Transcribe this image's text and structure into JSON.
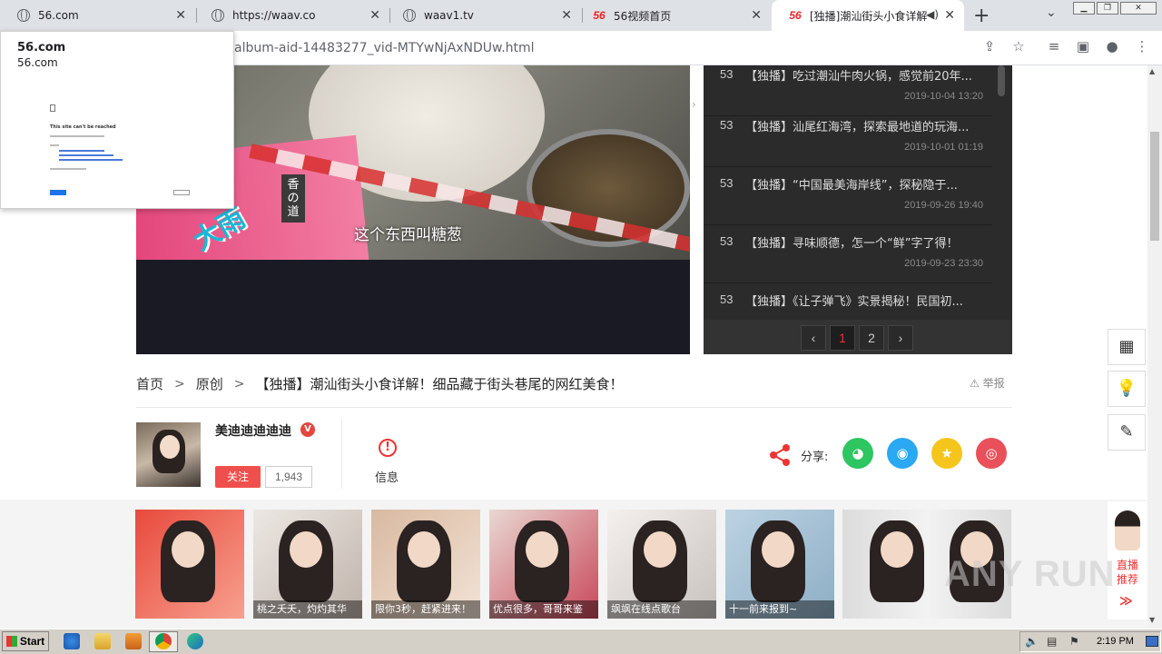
{
  "browser": {
    "tabs": [
      {
        "label": "56.com"
      },
      {
        "label": "https://waav.co"
      },
      {
        "label": "waav1.tv"
      },
      {
        "label": "56视频首页"
      },
      {
        "label": "[独播]潮汕街头小食详解"
      }
    ],
    "url": "album-aid-14483277_vid-MTYwNjAxNDUw.html"
  },
  "popup": {
    "title": "56.com",
    "url": "56.com",
    "error_text": "This site can't be reached"
  },
  "video": {
    "subtitle": "这个东西叫糖葱",
    "overlay_big": "大雨",
    "overlay_vertical": "香の道"
  },
  "playlist": {
    "items": [
      {
        "num": "53",
        "title": "【独播】吃过潮汕牛肉火锅，感觉前20年...",
        "date": "2019-10-04 13:20"
      },
      {
        "num": "53",
        "title": "【独播】汕尾红海湾，探索最地道的玩海...",
        "date": "2019-10-01 01:19"
      },
      {
        "num": "53",
        "title": "【独播】“中国最美海岸线”，探秘隐于...",
        "date": "2019-09-26 19:40"
      },
      {
        "num": "53",
        "title": "【独播】寻味顺德，怎一个“鲜”字了得！",
        "date": "2019-09-23 23:30"
      },
      {
        "num": "53",
        "title": "【独播】《让子弹飞》实景揭秘！民国初...",
        "date": ""
      }
    ],
    "pages": [
      "1",
      "2"
    ],
    "prev": "‹",
    "next": "›"
  },
  "breadcrumb": {
    "home": "首页",
    "category": "原创",
    "title": "【独播】潮汕街头小食详解！细品藏于街头巷尾的网红美食！",
    "report": "举报"
  },
  "uploader": {
    "name": "美迪迪迪迪迪",
    "badge": "V",
    "follow": "关注",
    "fans": "1,943",
    "info_label": "信息"
  },
  "share": {
    "label": "分享:"
  },
  "recommend": {
    "items": [
      {
        "caption": ""
      },
      {
        "caption": "桃之夭夭，灼灼其华"
      },
      {
        "caption": "限你3秒，赶紧进来！"
      },
      {
        "caption": "优点很多，哥哥来鉴"
      },
      {
        "caption": "飒飒在线点歌台"
      },
      {
        "caption": "十一前来报到~"
      },
      {
        "caption": ""
      }
    ],
    "live_label": "直播推荐",
    "live_arrow": "≫"
  },
  "watermark": "ANY RUN",
  "taskbar": {
    "start": "Start",
    "clock": "2:19 PM"
  }
}
